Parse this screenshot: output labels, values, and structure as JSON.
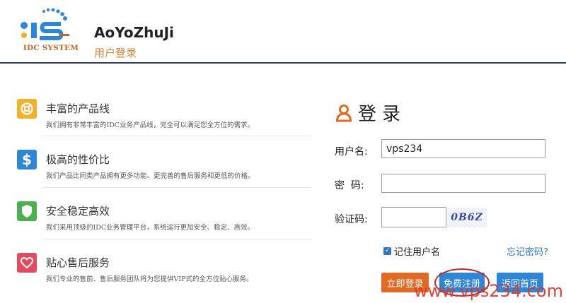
{
  "header": {
    "logo_text": "IDC SYSTEM",
    "site_name": "AoYoZhuJi",
    "subtitle": "用户登录"
  },
  "features": [
    {
      "title": "丰富的产品线",
      "desc": "我们拥有非常丰富的IDC业务产品线，完全可以满足您全方位的需求。",
      "icon": "lifebuoy-icon",
      "color": "#f2b12d"
    },
    {
      "title": "极高的性价比",
      "desc": "我们产品比同类产品拥有更多功能、更完善的售后服务和更低的价格。",
      "icon": "dollar-icon",
      "color": "#2f86d6"
    },
    {
      "title": "安全稳定高效",
      "desc": "我们采用顶级的IDC业务管理平台，系统运行更加安全、稳定、高效。",
      "icon": "shield-icon",
      "color": "#4caf50"
    },
    {
      "title": "贴心售后服务",
      "desc": "我们专业的售前、售后服务团队将为您提供VIP式的全方位贴心服务。",
      "icon": "heart-icon",
      "color": "#e04b5f"
    }
  ],
  "login": {
    "title": "登录",
    "username_label": "用户名:",
    "username_value": "vps234",
    "password_label": "密  码:",
    "captcha_label": "验证码:",
    "captcha_text": "0B6Z",
    "remember_label": "记住用户名",
    "forgot_label": "忘记密码?",
    "login_button": "立即登录",
    "register_button": "免费注册",
    "home_button": "返回首页"
  },
  "watermark": "www.vps234.com",
  "colors": {
    "accent_orange": "#e06a24",
    "accent_blue": "#2f85d6",
    "header_line": "#2f3f58"
  }
}
